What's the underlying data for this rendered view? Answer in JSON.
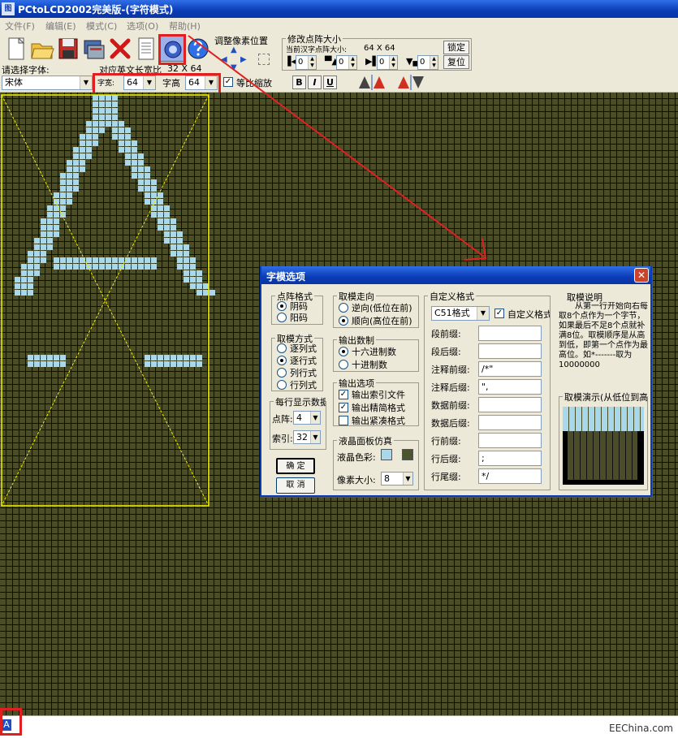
{
  "window": {
    "title": "PCtoLCD2002完美版-(字符模式)",
    "app_icon": "图标"
  },
  "menu": [
    "文件(F)",
    "编辑(E)",
    "模式(C)",
    "选项(O)",
    "帮助(H)"
  ],
  "toolbar": {
    "tools": [
      "new-icon",
      "open-icon",
      "save-icon",
      "generate-icon",
      "delete-icon",
      "document-icon",
      "settings-icon",
      "help-icon"
    ],
    "adjust_pixel_label": "调整像素位置",
    "resize_group_label": "修改点阵大小",
    "current_size_label": "当前汉字点阵大小:",
    "current_size_value": "64  X  64",
    "lock_button": "锁定",
    "reset_button": "复位",
    "spins": [
      "0",
      "0",
      "0",
      "0"
    ],
    "font_prompt": "请选择字体:",
    "english_width_label": "对应英文长宽比",
    "english_width_value": "32  X  64",
    "font_name": "宋体",
    "char_width_label": "字宽:",
    "char_width_value": "64",
    "char_height_label": "字高",
    "char_height_value": "64",
    "proportional_label": "等比缩放",
    "proportional_checked": "✓",
    "bold": "B",
    "italic": "I",
    "underline": "U"
  },
  "canvas": {
    "grid_color": "#4a4d28",
    "pixel_color": "#a8d8ea",
    "frame_color": "#f2f200"
  },
  "status": {
    "cursor_char": "A",
    "watermark": "EEChina.com"
  },
  "dialog": {
    "title": "字模选项",
    "close": "✕",
    "dot_format": {
      "legend": "点阵格式",
      "options": [
        "阴码",
        "阳码"
      ],
      "selected": 0
    },
    "scan_mode": {
      "legend": "取模方式",
      "options": [
        "逐列式",
        "逐行式",
        "列行式",
        "行列式"
      ],
      "selected": 1
    },
    "per_row": {
      "legend": "每行显示数据",
      "dot_label": "点阵:",
      "dot_value": "4",
      "index_label": "索引:",
      "index_value": "32"
    },
    "ok_button": "确  定",
    "cancel_button": "取  消",
    "direction": {
      "legend": "取模走向",
      "options": [
        "逆向(低位在前)",
        "顺向(高位在前)"
      ],
      "selected": 1
    },
    "radix": {
      "legend": "输出数制",
      "options": [
        "十六进制数",
        "十进制数"
      ],
      "selected": 0
    },
    "output": {
      "legend": "输出选项",
      "options": [
        "输出索引文件",
        "输出精简格式",
        "输出紧凑格式"
      ],
      "checked": [
        true,
        true,
        false
      ]
    },
    "lcd": {
      "legend": "液晶面板仿真",
      "color_label": "液晶色彩:",
      "pixel_size_label": "像素大小:",
      "pixel_size_value": "8",
      "color_a": "#a8d8ea",
      "color_b": "#4a5530"
    },
    "custom": {
      "legend": "自定义格式",
      "format_value": "C51格式",
      "custom_label": "自定义格式",
      "fields": [
        {
          "label": "段前缀:",
          "value": ""
        },
        {
          "label": "段后缀:",
          "value": ""
        },
        {
          "label": "注释前缀:",
          "value": "/*\""
        },
        {
          "label": "注释后缀:",
          "value": "\","
        },
        {
          "label": "数据前缀:",
          "value": ""
        },
        {
          "label": "数据后缀:",
          "value": ""
        },
        {
          "label": "行前缀:",
          "value": ""
        },
        {
          "label": "行后缀:",
          "value": ";"
        },
        {
          "label": "行尾缀:",
          "value": "*/"
        }
      ]
    },
    "note": {
      "legend": "取模说明",
      "text": "从第一行开始向右每取8个点作为一个字节，如果最后不足8个点就补满8位。取模顺序是从高到低，即第一个点作为最高位。如*-------取为10000000"
    },
    "demo": {
      "legend": "取模演示(从低位到高位)"
    }
  }
}
